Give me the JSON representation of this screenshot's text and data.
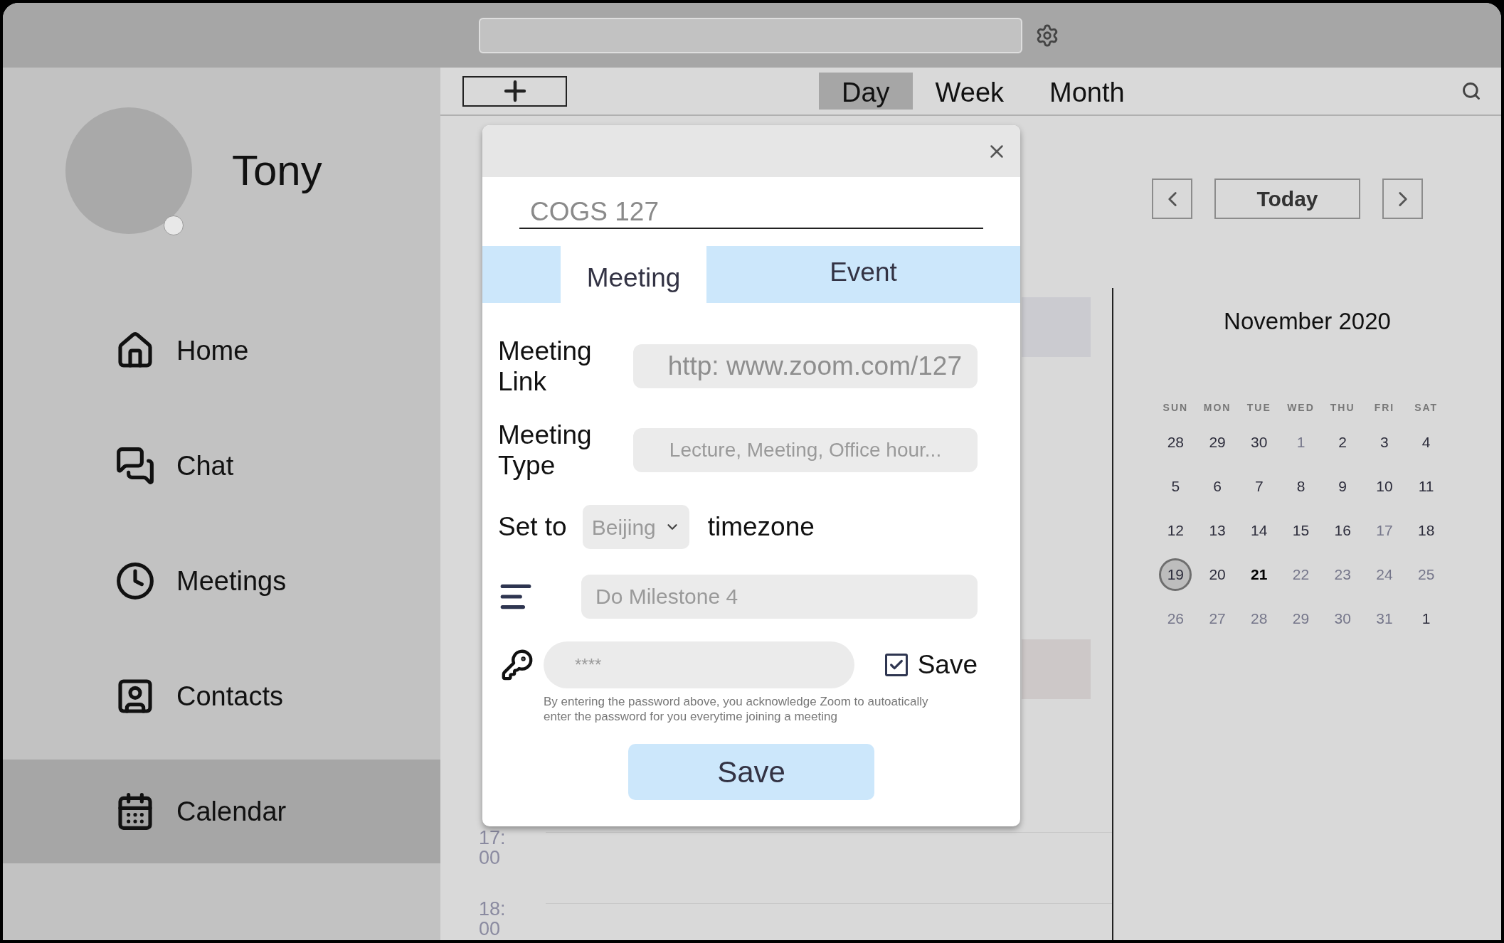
{
  "user": {
    "name": "Tony"
  },
  "sidebar": {
    "items": [
      {
        "kind": "home",
        "label": "Home",
        "selected": false
      },
      {
        "kind": "chat",
        "label": "Chat",
        "selected": false
      },
      {
        "kind": "meetings",
        "label": "Meetings",
        "selected": false
      },
      {
        "kind": "contacts",
        "label": "Contacts",
        "selected": false
      },
      {
        "kind": "calendar",
        "label": "Calendar",
        "selected": true
      }
    ]
  },
  "view_tabs": [
    {
      "label": "Day",
      "selected": true
    },
    {
      "label": "Week",
      "selected": false
    },
    {
      "label": "Month",
      "selected": false
    }
  ],
  "time_labels": [
    {
      "hour": "17:",
      "minutes": "00"
    },
    {
      "hour": "18:",
      "minutes": "00"
    }
  ],
  "navigation": {
    "today": "Today"
  },
  "mini_calendar": {
    "title": "November 2020",
    "weekdays": [
      "SUN",
      "MON",
      "TUE",
      "WED",
      "THU",
      "FRI",
      "SAT"
    ],
    "days": [
      {
        "label": "28",
        "muted": false,
        "bold": false,
        "selected": false
      },
      {
        "label": "29",
        "muted": false,
        "bold": false,
        "selected": false
      },
      {
        "label": "30",
        "muted": false,
        "bold": false,
        "selected": false
      },
      {
        "label": "1",
        "muted": true,
        "bold": false,
        "selected": false
      },
      {
        "label": "2",
        "muted": false,
        "bold": false,
        "selected": false
      },
      {
        "label": "3",
        "muted": false,
        "bold": false,
        "selected": false
      },
      {
        "label": "4",
        "muted": false,
        "bold": false,
        "selected": false
      },
      {
        "label": "5",
        "muted": false,
        "bold": false,
        "selected": false
      },
      {
        "label": "6",
        "muted": false,
        "bold": false,
        "selected": false
      },
      {
        "label": "7",
        "muted": false,
        "bold": false,
        "selected": false
      },
      {
        "label": "8",
        "muted": false,
        "bold": false,
        "selected": false
      },
      {
        "label": "9",
        "muted": false,
        "bold": false,
        "selected": false
      },
      {
        "label": "10",
        "muted": false,
        "bold": false,
        "selected": false
      },
      {
        "label": "11",
        "muted": false,
        "bold": false,
        "selected": false
      },
      {
        "label": "12",
        "muted": false,
        "bold": false,
        "selected": false
      },
      {
        "label": "13",
        "muted": false,
        "bold": false,
        "selected": false
      },
      {
        "label": "14",
        "muted": false,
        "bold": false,
        "selected": false
      },
      {
        "label": "15",
        "muted": false,
        "bold": false,
        "selected": false
      },
      {
        "label": "16",
        "muted": false,
        "bold": false,
        "selected": false
      },
      {
        "label": "17",
        "muted": true,
        "bold": false,
        "selected": false
      },
      {
        "label": "18",
        "muted": false,
        "bold": false,
        "selected": false
      },
      {
        "label": "19",
        "muted": false,
        "bold": false,
        "selected": true
      },
      {
        "label": "20",
        "muted": false,
        "bold": false,
        "selected": false
      },
      {
        "label": "21",
        "muted": false,
        "bold": true,
        "selected": false
      },
      {
        "label": "22",
        "muted": true,
        "bold": false,
        "selected": false
      },
      {
        "label": "23",
        "muted": true,
        "bold": false,
        "selected": false
      },
      {
        "label": "24",
        "muted": true,
        "bold": false,
        "selected": false
      },
      {
        "label": "25",
        "muted": true,
        "bold": false,
        "selected": false
      },
      {
        "label": "26",
        "muted": true,
        "bold": false,
        "selected": false
      },
      {
        "label": "27",
        "muted": true,
        "bold": false,
        "selected": false
      },
      {
        "label": "28",
        "muted": true,
        "bold": false,
        "selected": false
      },
      {
        "label": "29",
        "muted": true,
        "bold": false,
        "selected": false
      },
      {
        "label": "30",
        "muted": true,
        "bold": false,
        "selected": false
      },
      {
        "label": "31",
        "muted": true,
        "bold": false,
        "selected": false
      },
      {
        "label": "1",
        "muted": false,
        "bold": false,
        "selected": false
      }
    ]
  },
  "dialog": {
    "title": {
      "value": "COGS 127"
    },
    "tabs": [
      {
        "label": "Meeting",
        "selected": true
      },
      {
        "label": "Event",
        "selected": false
      }
    ],
    "meeting_link": {
      "label": "Meeting Link",
      "value": "http: www.zoom.com/127"
    },
    "meeting_type": {
      "label": "Meeting Type",
      "placeholder": "Lecture, Meeting, Office hour..."
    },
    "timezone": {
      "prefix": "Set to",
      "value": "Beijing",
      "suffix": "timezone"
    },
    "description": {
      "placeholder": "Do Milestone 4"
    },
    "password": {
      "value": "****",
      "save_label": "Save",
      "save_checked": true,
      "note": "By entering the password above, you acknowledge Zoom to autoatically enter the password for you everytime joining a meeting"
    },
    "save_button": "Save"
  }
}
